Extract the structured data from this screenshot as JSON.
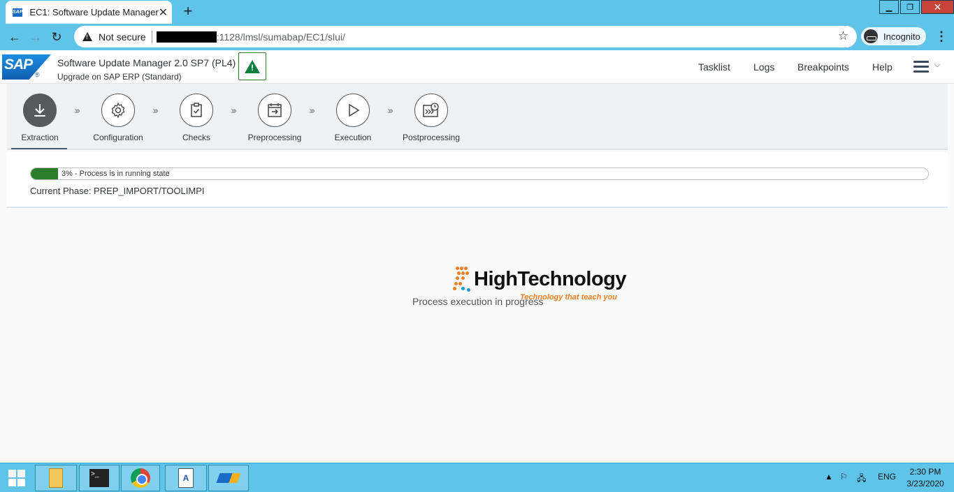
{
  "browser": {
    "tab_title": "EC1: Software Update Manager",
    "tab_favicon": "SAP",
    "security_label": "Not secure",
    "url": ":1128/lmsl/sumabap/EC1/slui/",
    "incognito_label": "Incognito"
  },
  "header": {
    "logo": "SAP",
    "title": "Software Update Manager 2.0 SP7 (PL4)",
    "subtitle": "Upgrade on SAP ERP (Standard)",
    "nav": [
      "Tasklist",
      "Logs",
      "Breakpoints",
      "Help"
    ]
  },
  "roadmap": {
    "steps": [
      {
        "label": "Extraction",
        "icon": "download-icon",
        "active": true
      },
      {
        "label": "Configuration",
        "icon": "gear-icon",
        "active": false
      },
      {
        "label": "Checks",
        "icon": "clipboard-check-icon",
        "active": false
      },
      {
        "label": "Preprocessing",
        "icon": "calendar-arrow-icon",
        "active": false
      },
      {
        "label": "Execution",
        "icon": "play-icon",
        "active": false
      },
      {
        "label": "Postprocessing",
        "icon": "history-icon",
        "active": false
      }
    ]
  },
  "progress": {
    "percent": 3,
    "text": "3% - Process is in running state",
    "phase": "Current Phase: PREP_IMPORT/TOOLIMPI",
    "fill_color": "#2b7d2b"
  },
  "main": {
    "status_text": "Process execution in progress"
  },
  "watermark": {
    "title": "HighTechnology",
    "tagline": "Technology that teach you"
  },
  "taskbar": {
    "language": "ENG",
    "time": "2:30 PM",
    "date": "3/23/2020"
  }
}
